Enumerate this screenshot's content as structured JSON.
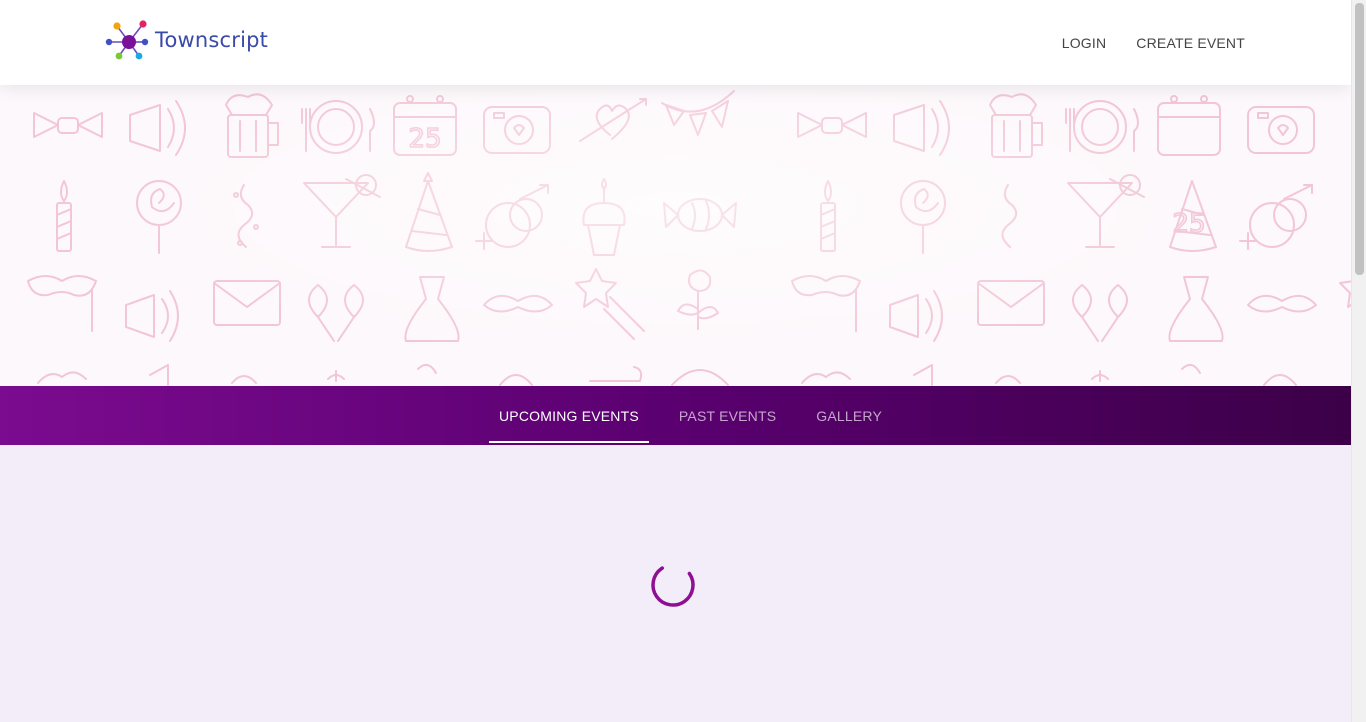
{
  "header": {
    "logo_text": "Townscript",
    "nav": {
      "login_label": "LOGIN",
      "create_event_label": "CREATE EVENT"
    }
  },
  "tabs": [
    {
      "label": "UPCOMING EVENTS",
      "active": true
    },
    {
      "label": "PAST EVENTS",
      "active": false
    },
    {
      "label": "GALLERY",
      "active": false
    }
  ],
  "content": {
    "status": "loading",
    "spinner_icon": "loading-spinner-icon"
  },
  "colors": {
    "brand_text": "#3a4aa8",
    "tab_bar_start": "#7b0b8f",
    "tab_bar_end": "#3c0048",
    "content_background": "#f3ecf9",
    "spinner": "#8e0f92",
    "banner_pattern": "#f2c6d6"
  },
  "banner": {
    "pattern_icons": [
      "bow-tie-icon",
      "megaphone-icon",
      "beer-mug-icon",
      "plate-cutlery-icon",
      "calendar-icon",
      "camera-icon",
      "heart-arrow-icon",
      "bunting-icon",
      "candle-icon",
      "lollipop-icon",
      "streamer-icon",
      "cocktail-icon",
      "party-hat-icon",
      "rings-icon",
      "cupcake-icon",
      "candy-icon",
      "mask-icon",
      "envelope-icon",
      "balloons-icon",
      "dress-icon",
      "mustache-icon",
      "shooting-star-icon",
      "rose-icon"
    ],
    "calendar_number": "25"
  }
}
